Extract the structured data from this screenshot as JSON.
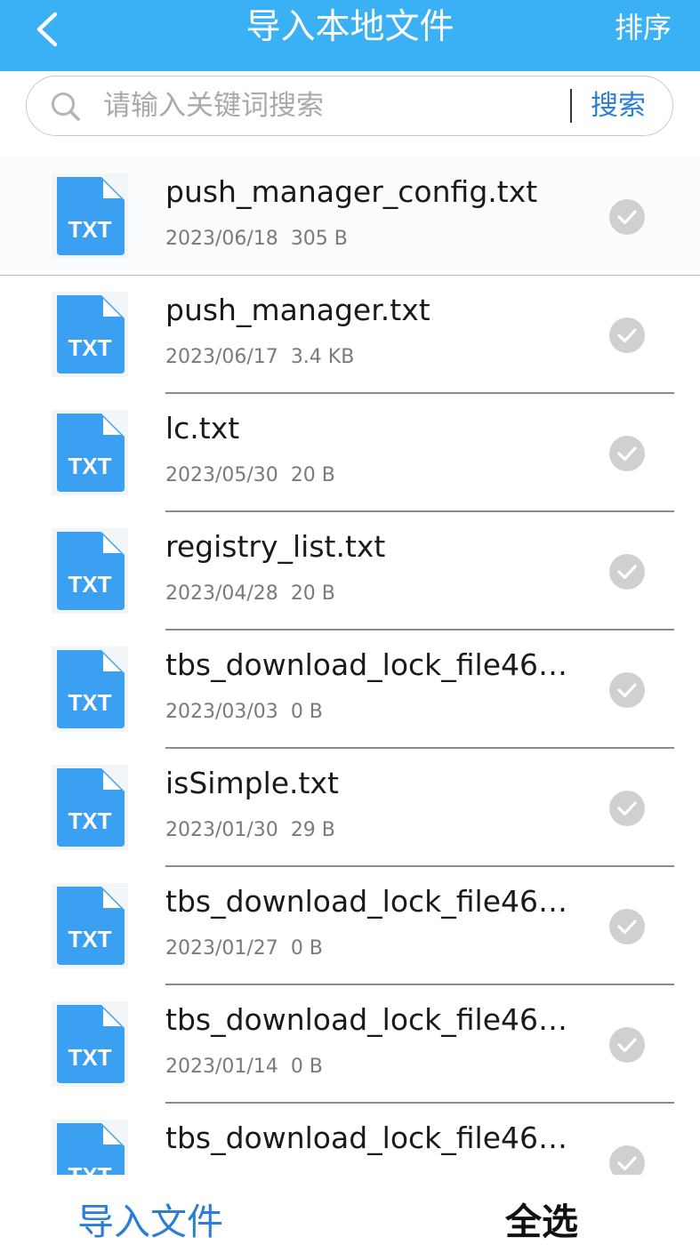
{
  "header": {
    "title": "导入本地文件",
    "sort_label": "排序",
    "back_icon": "chevron-left-icon"
  },
  "search": {
    "placeholder": "请输入关键词搜索",
    "value": "",
    "button_label": "搜索",
    "icon": "search-icon"
  },
  "files": [
    {
      "name": "push_manager_config.txt",
      "date": "2023/06/18",
      "size": "305 B",
      "icon_label": "TXT",
      "selected": false
    },
    {
      "name": "push_manager.txt",
      "date": "2023/06/17",
      "size": "3.4 KB",
      "icon_label": "TXT",
      "selected": false
    },
    {
      "name": "lc.txt",
      "date": "2023/05/30",
      "size": "20 B",
      "icon_label": "TXT",
      "selected": false
    },
    {
      "name": "registry_list.txt",
      "date": "2023/04/28",
      "size": "20 B",
      "icon_label": "TXT",
      "selected": false
    },
    {
      "name": "tbs_download_lock_file46…",
      "date": "2023/03/03",
      "size": "0 B",
      "icon_label": "TXT",
      "selected": false
    },
    {
      "name": "isSimple.txt",
      "date": "2023/01/30",
      "size": "29 B",
      "icon_label": "TXT",
      "selected": false
    },
    {
      "name": "tbs_download_lock_file46…",
      "date": "2023/01/27",
      "size": "0 B",
      "icon_label": "TXT",
      "selected": false
    },
    {
      "name": "tbs_download_lock_file46…",
      "date": "2023/01/14",
      "size": "0 B",
      "icon_label": "TXT",
      "selected": false
    },
    {
      "name": "tbs_download_lock_file46…",
      "date": "",
      "size": "",
      "icon_label": "TXT",
      "selected": false
    }
  ],
  "footer": {
    "import_label": "导入文件",
    "select_all_label": "全选"
  },
  "colors": {
    "header_bg": "#3ab0f5",
    "accent": "#2a7fd4",
    "file_icon": "#3b9ff2",
    "check_inactive": "#d0d0d0"
  }
}
